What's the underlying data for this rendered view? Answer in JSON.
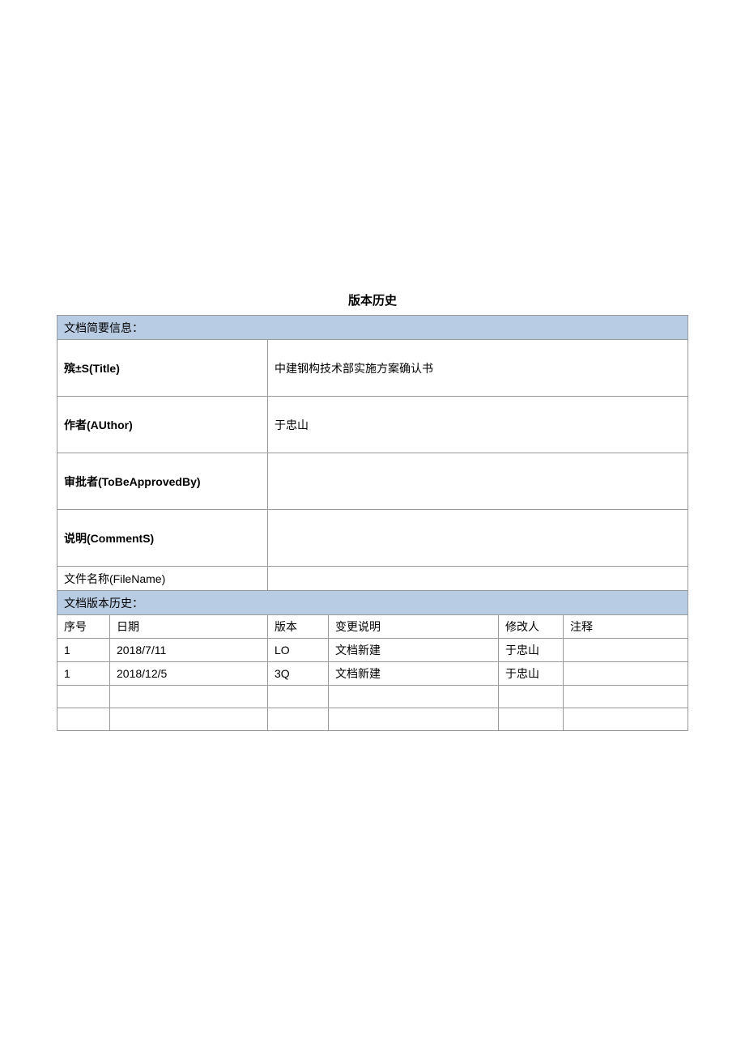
{
  "page_title": "版本历史",
  "doc_brief_label": "文档简要信息：",
  "info": {
    "title_label": "殡±S(Title)",
    "title_value": "中建钢构技术部实施方案确认书",
    "author_label": "作者(AUthor)",
    "author_value": "于忠山",
    "approver_label": "审批者(ToBeApprovedBy)",
    "approver_value": "",
    "comments_label": "说明(CommentS)",
    "comments_value": "",
    "filename_label": "文件名称(FileName)",
    "filename_value": ""
  },
  "history_header_label": "文档版本历史：",
  "history_columns": {
    "seq": "序号",
    "date": "日期",
    "version": "版本",
    "change": "变更说明",
    "modifier": "修改人",
    "note": "注释"
  },
  "history_rows": [
    {
      "seq": "1",
      "date": "2018/7/11",
      "version": "LO",
      "change": "文档新建",
      "modifier": "于忠山",
      "note": ""
    },
    {
      "seq": "1",
      "date": "2018/12/5",
      "version": "3Q",
      "change": "文档新建",
      "modifier": "于忠山",
      "note": ""
    },
    {
      "seq": "",
      "date": "",
      "version": "",
      "change": "",
      "modifier": "",
      "note": ""
    },
    {
      "seq": "",
      "date": "",
      "version": "",
      "change": "",
      "modifier": "",
      "note": ""
    }
  ]
}
